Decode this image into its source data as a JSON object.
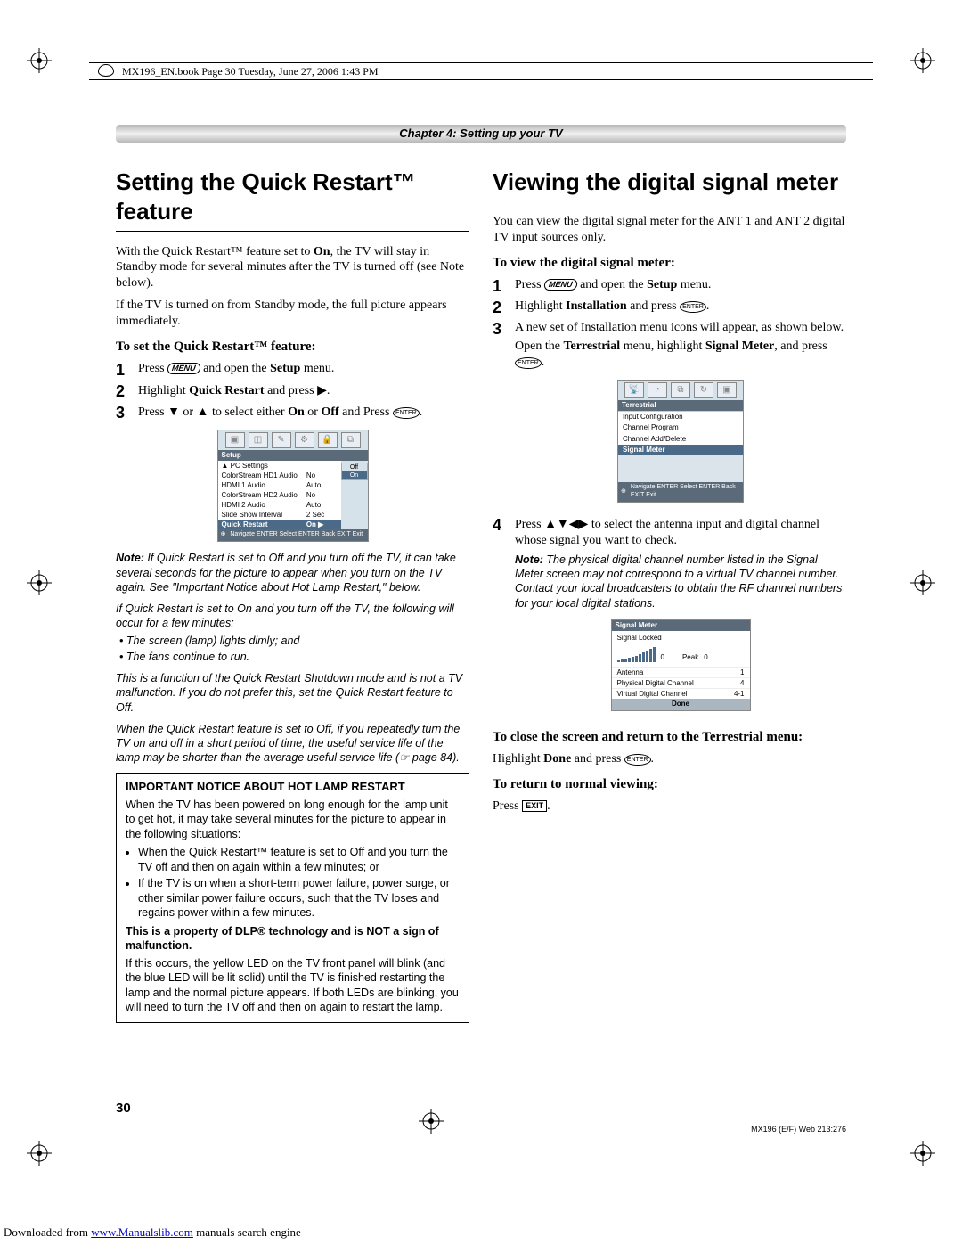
{
  "print_header": "MX196_EN.book  Page 30  Tuesday, June 27, 2006  1:43 PM",
  "chapter": "Chapter 4: Setting up your TV",
  "left": {
    "title": "Setting the Quick Restart™ feature",
    "p1a": "With the Quick Restart™ feature set to ",
    "p1b": "On",
    "p1c": ", the TV will stay in Standby mode for several minutes after the TV is turned off (see Note below).",
    "p2": "If the TV is turned on from Standby mode, the full picture appears immediately.",
    "sub": "To set the Quick Restart™ feature:",
    "s1a": "Press ",
    "s1b": " and open the ",
    "s1c": "Setup",
    "s1d": " menu.",
    "s2a": "Highlight ",
    "s2b": "Quick Restart",
    "s2c": " and press ",
    "s3a": "Press ",
    "s3b": " or ",
    "s3c": " to select either ",
    "s3d": "On",
    "s3e": " or ",
    "s3f": "Off",
    "s3g": " and Press ",
    "note1_lead": "Note:",
    "note1_body": " If Quick Restart is set to Off and you turn off the TV, it can take several seconds for the picture to appear when you turn on the TV again. See \"Important Notice about Hot Lamp Restart,\" below.",
    "note2_intro": "If Quick Restart is set to On and you turn off the TV, the following will occur for a few minutes:",
    "note2_b1": "The screen (lamp) lights dimly; and",
    "note2_b2": "The fans continue to run.",
    "note3": "This is a function of the Quick Restart Shutdown mode and is not a TV malfunction. If you do not prefer this, set the Quick Restart feature to Off.",
    "note4": "When the Quick Restart feature is set to Off, if you repeatedly turn the TV on and off in a short period of time, the useful service life of the lamp may be shorter than the average useful service life (☞ page 84).",
    "box_title": "IMPORTANT NOTICE ABOUT HOT LAMP RESTART",
    "box_p1": "When the TV has been powered on long enough for the lamp unit to get hot, it may take several minutes for the picture to appear in the following situations:",
    "box_b1": "When the Quick Restart™ feature is set to Off and you turn the TV off and then on again within a few minutes; or",
    "box_b2": "If the TV is on when a short-term power failure, power surge, or other similar power failure occurs, such that the TV loses and regains power within a few minutes.",
    "box_strong": "This is a property of DLP® technology and is NOT a sign of malfunction.",
    "box_p2": "If this occurs, the yellow LED on the TV front panel will blink (and the blue LED will be lit solid) until the TV is finished restarting the lamp and the normal picture appears. If both LEDs are blinking, you will need to turn the TV off and then on again to restart the lamp.",
    "osd": {
      "title": "Setup",
      "rows": [
        {
          "c1": "PC Settings",
          "c2": ""
        },
        {
          "c1": "ColorStream HD1 Audio",
          "c2": "No"
        },
        {
          "c1": "HDMI 1 Audio",
          "c2": "Auto"
        },
        {
          "c1": "ColorStream HD2 Audio",
          "c2": "No"
        },
        {
          "c1": "HDMI 2 Audio",
          "c2": "Auto"
        },
        {
          "c1": "Slide Show Interval",
          "c2": "2 Sec"
        }
      ],
      "hl": {
        "c1": "Quick Restart",
        "c2": "On ▶"
      },
      "off": "Off",
      "on": "On",
      "nav": "Navigate   ENTER Select   ENTER Back   EXIT Exit"
    }
  },
  "right": {
    "title": "Viewing the digital signal meter",
    "p1": "You can view the digital signal meter for the ANT 1 and ANT 2 digital TV input sources only.",
    "sub": "To view the digital signal meter:",
    "s1a": "Press ",
    "s1b": " and open the ",
    "s1c": "Setup",
    "s1d": " menu.",
    "s2a": "Highlight ",
    "s2b": "Installation",
    "s2c": " and press ",
    "s3a": "A new set of Installation menu icons will appear, as shown below.",
    "s3b": "Open the ",
    "s3c": "Terrestrial",
    "s3d": " menu, highlight ",
    "s3e": "Signal Meter",
    "s3f": ", and press ",
    "s4a": "Press ",
    "s4b": " to select the antenna input and digital channel whose signal you want to check.",
    "note_lead": "Note:",
    "note_body": " The physical digital channel number listed in the Signal Meter screen may not correspond to a virtual TV channel number. Contact your local broadcasters to obtain the RF channel numbers for your local digital stations.",
    "close_sub": "To close the screen and return to the Terrestrial menu:",
    "close_body_a": "Highlight ",
    "close_body_b": "Done",
    "close_body_c": " and press ",
    "return_sub": "To return to normal viewing:",
    "return_body": "Press ",
    "osd_terr": {
      "title": "Terrestrial",
      "items": [
        "Input Configuration",
        "Channel Program",
        "Channel Add/Delete",
        "Signal Meter"
      ],
      "nav": "Navigate   ENTER Select   ENTER Back   EXIT Exit"
    },
    "osd_signal": {
      "title": "Signal Meter",
      "locked": "Signal Locked",
      "zero": "0",
      "peak": "Peak",
      "peakv": "0",
      "rows": [
        {
          "l": "Antenna",
          "r": "1"
        },
        {
          "l": "Physical Digital Channel",
          "r": "4"
        },
        {
          "l": "Virtual Digital Channel",
          "r": "4-1"
        }
      ],
      "done": "Done"
    }
  },
  "labels": {
    "menu": "MENU",
    "enter": "ENTER",
    "exit": "EXIT"
  },
  "page_number": "30",
  "doc_code": "MX196 (E/F) Web 213:276",
  "download_pre": "Downloaded from ",
  "download_link": "www.Manualslib.com",
  "download_post": " manuals search engine"
}
